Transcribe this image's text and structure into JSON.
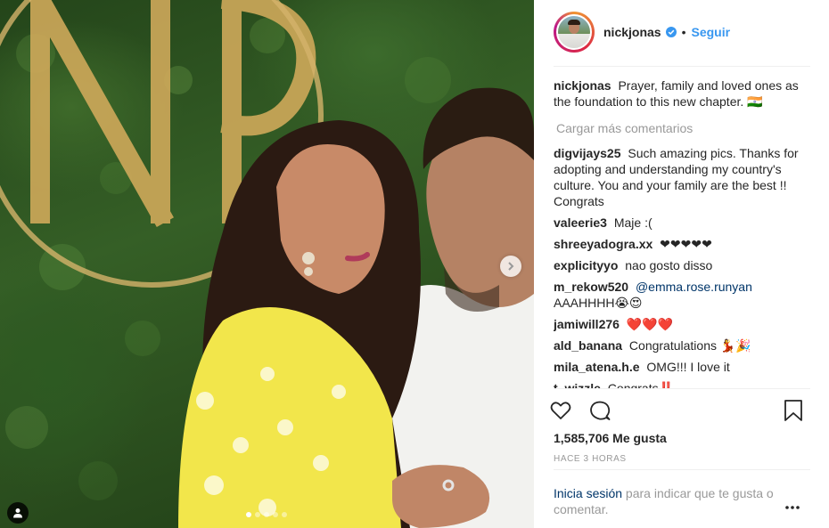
{
  "post": {
    "username": "nickjonas",
    "follow_label": "Seguir",
    "separator": "•",
    "caption_user": "nickjonas",
    "caption_text": "Prayer, family and loved ones as the foundation to this new chapter. 🇮🇳",
    "load_more_label": "Cargar más comentarios",
    "comments": [
      {
        "user": "digvijays25",
        "text": "Such amazing pics. Thanks for adopting and understanding my country's culture. You and your family are the best !! Congrats"
      },
      {
        "user": "valeerie3",
        "text": "Maje :("
      },
      {
        "user": "shreeyadogra.xx",
        "text": "❤❤❤❤❤"
      },
      {
        "user": "explicityyo",
        "text": "nao gosto disso"
      },
      {
        "user": "m_rekow520",
        "mention": "@emma.rose.runyan",
        "text": "AAAHHHH😭😍"
      },
      {
        "user": "jamiwill276",
        "text": "❤️❤️❤️"
      },
      {
        "user": "ald_banana",
        "text": "Congratulations 💃🎉"
      },
      {
        "user": "mila_atena.h.e",
        "text": "OMG!!! I love it"
      },
      {
        "user": "t_wizzle",
        "text": "Congrats‼️"
      }
    ],
    "likes_label": "1,585,706 Me gusta",
    "time_label": "HACE 3 HORAS",
    "login_link": "Inicia sesión",
    "login_rest": " para indicar que te gusta o comentar.",
    "photo_monogram": "NP",
    "carousel_count": 5,
    "carousel_active": 1,
    "accent_color": "#3897f0"
  }
}
